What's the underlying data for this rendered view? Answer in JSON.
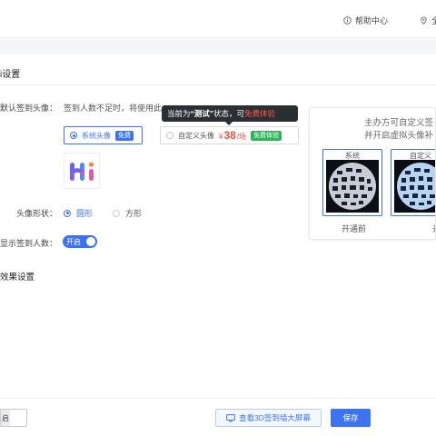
{
  "header": {
    "help_label": "帮助中心",
    "location_label": "全"
  },
  "sections": {
    "avatar_settings_title": "i设置",
    "effect_settings_title": "效果设置"
  },
  "default_avatar": {
    "label": "默认签到头像：",
    "description": "签到人数不足时，将使用此",
    "options": [
      {
        "label": "系统头像",
        "badge": "免费",
        "selected": true
      },
      {
        "label": "自定义头像",
        "price_symbol": "¥",
        "price_value": "38",
        "price_unit": "/场",
        "badge": "免费体验",
        "selected": false
      }
    ],
    "tooltip": {
      "prefix": "当前为",
      "status": "“测试”",
      "middle": "状态，可",
      "highlight": "免费体验"
    }
  },
  "avatar_shape": {
    "label": "头像形状：",
    "options": [
      {
        "label": "圆形",
        "selected": true
      },
      {
        "label": "方形",
        "selected": false
      }
    ]
  },
  "show_count": {
    "label": "显示签到人数：",
    "toggle_label": "开启",
    "enabled": true
  },
  "preview": {
    "line1": "主办方可自定义签",
    "line2": "并开启虚拟头像补",
    "frames": [
      {
        "tag": "系统",
        "caption": "开通前"
      },
      {
        "tag": "自定义",
        "caption": "开"
      }
    ]
  },
  "footer": {
    "toggle_label": "启",
    "view_button": "查看3D签到墙大屏幕",
    "save_button": "保存"
  },
  "colors": {
    "primary": "#3b73f0",
    "price_red": "#f24e3a",
    "badge_green": "#2fb45a",
    "tooltip_bg": "#2b2e33"
  }
}
